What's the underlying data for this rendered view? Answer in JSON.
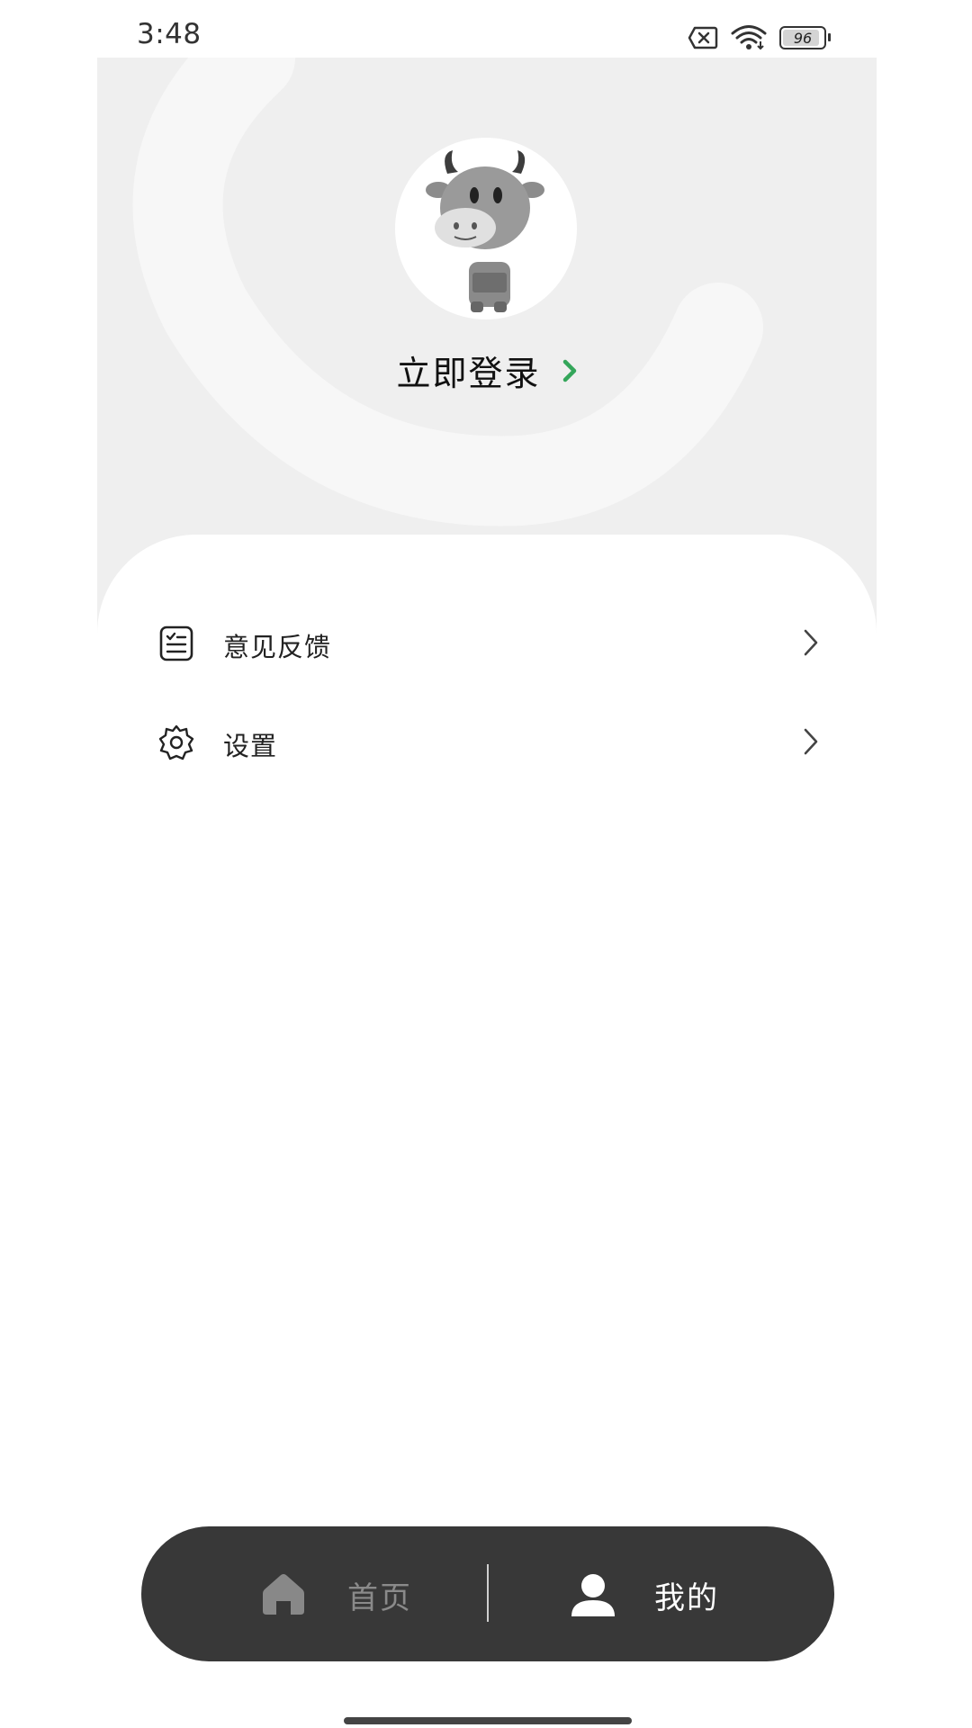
{
  "status_bar": {
    "time": "3:48",
    "battery_level": "96",
    "icons": [
      "sim-off-icon",
      "wifi-icon",
      "battery-icon"
    ]
  },
  "header": {
    "avatar": "cow-mascot-avatar",
    "login_label": "立即登录",
    "accent_color": "#34a65a"
  },
  "menu": {
    "items": [
      {
        "label": "意见反馈",
        "icon": "feedback-list-icon"
      },
      {
        "label": "设置",
        "icon": "settings-gear-icon"
      }
    ]
  },
  "tab_bar": {
    "tabs": [
      {
        "label": "首页",
        "icon": "home-icon",
        "selected": false
      },
      {
        "label": "我的",
        "icon": "person-icon",
        "selected": true
      }
    ]
  }
}
